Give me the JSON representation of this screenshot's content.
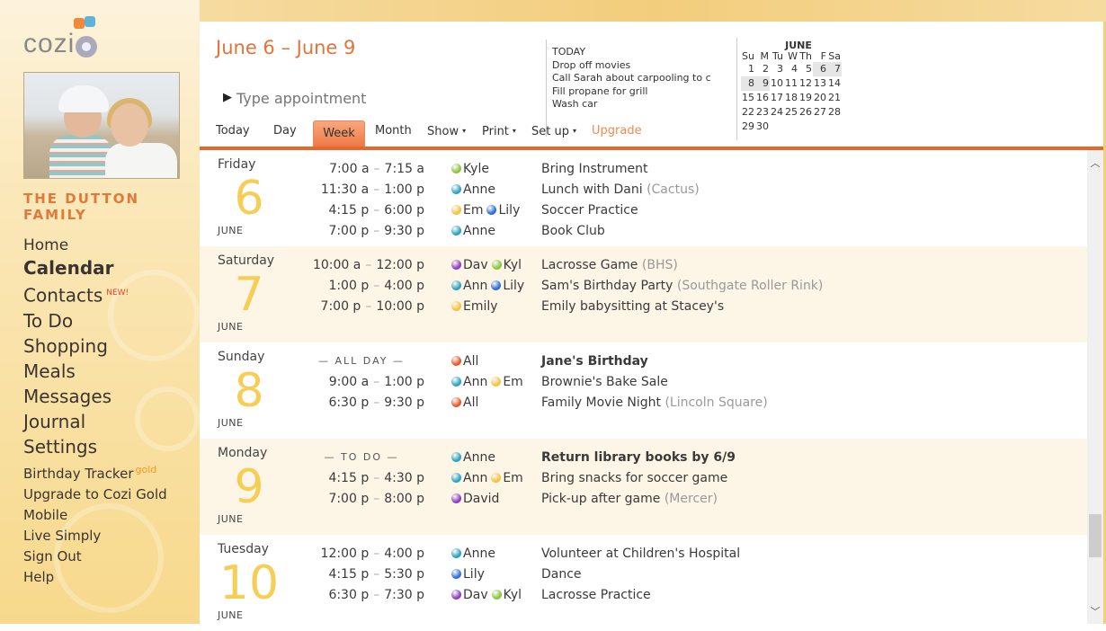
{
  "app": {
    "logo_text": "cozi",
    "family_name_line1": "THE DUTTON",
    "family_name_line2": "FAMILY",
    "photo_alt": "family-photo"
  },
  "sidebar": {
    "primary": [
      {
        "label": "Home",
        "active": false
      },
      {
        "label": "Calendar",
        "active": true
      },
      {
        "label": "Contacts",
        "badge": "NEW!",
        "active": false
      },
      {
        "label": "To Do",
        "active": false
      },
      {
        "label": "Shopping",
        "active": false
      },
      {
        "label": "Meals",
        "active": false
      },
      {
        "label": "Messages",
        "active": false
      },
      {
        "label": "Journal",
        "active": false
      },
      {
        "label": "Settings",
        "active": false
      }
    ],
    "secondary": [
      {
        "label": "Birthday Tracker",
        "badge": "gold"
      },
      {
        "label": "Upgrade to Cozi Gold"
      },
      {
        "label": "Mobile"
      },
      {
        "label": "Live Simply"
      },
      {
        "label": "Sign Out"
      },
      {
        "label": "Help"
      }
    ]
  },
  "header": {
    "date_range": "June 6 – June 9",
    "appointment_placeholder": "Type appointment",
    "tabs": [
      {
        "label": "Today"
      },
      {
        "label": "Day"
      },
      {
        "label": "Week",
        "active": true
      },
      {
        "label": "Month"
      },
      {
        "label": "Show",
        "dropdown": true
      },
      {
        "label": "Print",
        "dropdown": true
      },
      {
        "label": "Set up",
        "dropdown": true
      },
      {
        "label": "Upgrade",
        "highlight": true
      }
    ],
    "caret": "▾"
  },
  "todo_panel": {
    "title": "TODAY",
    "items": [
      "Drop off movies",
      "Call Sarah about carpooling to c",
      "Fill propane for grill",
      "Wash car"
    ]
  },
  "mini_calendar": {
    "month": "JUNE",
    "weekdays": [
      "Su",
      "M",
      "Tu",
      "W",
      "Th",
      "F",
      "Sa"
    ],
    "weeks": [
      [
        "1",
        "2",
        "3",
        "4",
        "5",
        "6",
        "7"
      ],
      [
        "8",
        "9",
        "10",
        "11",
        "12",
        "13",
        "14"
      ],
      [
        "15",
        "16",
        "17",
        "18",
        "19",
        "20",
        "21"
      ],
      [
        "22",
        "23",
        "24",
        "25",
        "26",
        "27",
        "28"
      ],
      [
        "29",
        "30",
        "",
        "",
        "",
        "",
        ""
      ]
    ],
    "highlighted": [
      "6",
      "7",
      "8",
      "9"
    ]
  },
  "people_colors": {
    "Kyle": "#8cc63f",
    "Anne": "#2ea3bf",
    "Emily": "#f5c242",
    "Lily": "#2f6fd6",
    "David": "#8e3fc0",
    "All": "#e8582a"
  },
  "days": [
    {
      "name": "Friday",
      "number": "6",
      "month": "JUNE",
      "events": [
        {
          "time_start": "7:00 a",
          "time_end": "7:15 a",
          "people": [
            {
              "name": "Kyle",
              "key": "Kyle"
            }
          ],
          "title": "Bring Instrument",
          "location": ""
        },
        {
          "time_start": "11:30 a",
          "time_end": "1:00 p",
          "people": [
            {
              "name": "Anne",
              "key": "Anne"
            }
          ],
          "title": "Lunch with Dani",
          "location": "(Cactus)"
        },
        {
          "time_start": "4:15 p",
          "time_end": "6:00 p",
          "people": [
            {
              "name": "Em",
              "key": "Emily"
            },
            {
              "name": "Lily",
              "key": "Lily"
            }
          ],
          "title": "Soccer Practice",
          "location": ""
        },
        {
          "time_start": "7:00 p",
          "time_end": "9:30 p",
          "people": [
            {
              "name": "Anne",
              "key": "Anne"
            }
          ],
          "title": "Book Club",
          "location": ""
        }
      ]
    },
    {
      "name": "Saturday",
      "number": "7",
      "month": "JUNE",
      "events": [
        {
          "time_start": "10:00 a",
          "time_end": "12:00 p",
          "people": [
            {
              "name": "Dav",
              "key": "David"
            },
            {
              "name": "Kyl",
              "key": "Kyle"
            }
          ],
          "title": "Lacrosse Game",
          "location": "(BHS)"
        },
        {
          "time_start": "1:00 p",
          "time_end": "4:00 p",
          "people": [
            {
              "name": "Ann",
              "key": "Anne"
            },
            {
              "name": "Lily",
              "key": "Lily"
            }
          ],
          "title": "Sam's Birthday Party",
          "location": "(Southgate Roller Rink)"
        },
        {
          "time_start": "7:00 p",
          "time_end": "10:00 p",
          "people": [
            {
              "name": "Emily",
              "key": "Emily"
            }
          ],
          "title": "Emily babysitting at Stacey's",
          "location": ""
        }
      ]
    },
    {
      "name": "Sunday",
      "number": "8",
      "month": "JUNE",
      "events": [
        {
          "label": "— ALL DAY —",
          "people": [
            {
              "name": "All",
              "key": "All"
            }
          ],
          "title": "Jane's Birthday",
          "location": "",
          "bold": true
        },
        {
          "time_start": "9:00 a",
          "time_end": "1:00 p",
          "people": [
            {
              "name": "Ann",
              "key": "Anne"
            },
            {
              "name": "Em",
              "key": "Emily"
            }
          ],
          "title": "Brownie's Bake Sale",
          "location": ""
        },
        {
          "time_start": "6:30 p",
          "time_end": "9:30 p",
          "people": [
            {
              "name": "All",
              "key": "All"
            }
          ],
          "title": "Family Movie Night",
          "location": "(Lincoln Square)"
        }
      ]
    },
    {
      "name": "Monday",
      "number": "9",
      "month": "JUNE",
      "events": [
        {
          "label": "— TO DO —",
          "people": [
            {
              "name": "Anne",
              "key": "Anne"
            }
          ],
          "title": "Return library books by 6/9",
          "location": "",
          "bold": true
        },
        {
          "time_start": "4:15 p",
          "time_end": "4:30 p",
          "people": [
            {
              "name": "Ann",
              "key": "Anne"
            },
            {
              "name": "Em",
              "key": "Emily"
            }
          ],
          "title": "Bring snacks for soccer game",
          "location": ""
        },
        {
          "time_start": "7:00 p",
          "time_end": "8:00 p",
          "people": [
            {
              "name": "David",
              "key": "David"
            }
          ],
          "title": "Pick-up after game",
          "location": "(Mercer)"
        }
      ]
    },
    {
      "name": "Tuesday",
      "number": "10",
      "month": "JUNE",
      "events": [
        {
          "time_start": "12:00 p",
          "time_end": "4:00 p",
          "people": [
            {
              "name": "Anne",
              "key": "Anne"
            }
          ],
          "title": "Volunteer at Children's Hospital",
          "location": ""
        },
        {
          "time_start": "4:15 p",
          "time_end": "5:30 p",
          "people": [
            {
              "name": "Lily",
              "key": "Lily"
            }
          ],
          "title": "Dance",
          "location": ""
        },
        {
          "time_start": "6:30 p",
          "time_end": "7:30 p",
          "people": [
            {
              "name": "Dav",
              "key": "David"
            },
            {
              "name": "Kyl",
              "key": "Kyle"
            }
          ],
          "title": "Lacrosse Practice",
          "location": ""
        }
      ]
    }
  ],
  "scrollbar": {
    "up_glyph": "^",
    "down_glyph": "v",
    "position_fraction": 0.85
  },
  "colors": {
    "accent": "#e5692f",
    "date_number": "#f6cd55",
    "alt_row": "#fdf5e6"
  }
}
